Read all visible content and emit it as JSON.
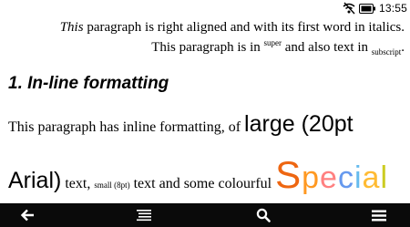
{
  "status_bar": {
    "time": "13:55",
    "icons": [
      "wifi-off-icon",
      "battery-icon"
    ]
  },
  "document": {
    "p1": {
      "em": "This",
      "rest": " paragraph is right aligned and with its first word in italics."
    },
    "p2": {
      "before": "This paragraph is in ",
      "sup": "super",
      "middle": " and also text in ",
      "sub": "subscript",
      "end": "."
    },
    "heading": "1. In-line formatting",
    "p3": {
      "t1": "This paragraph has inline formatting, of ",
      "large1": "large (20pt",
      "large2": "Arial)",
      "t2": " text, ",
      "small": "small (8pt)",
      "t3": " text and some colourful ",
      "special": [
        "S",
        "p",
        "e",
        "c",
        "i",
        "a",
        "l"
      ]
    }
  },
  "nav_bar": {
    "icons": [
      "back-arrow-icon",
      "menu-list-icon",
      "search-icon",
      "options-menu-icon"
    ]
  },
  "colors": {
    "nav_bg": "#0a0a0a",
    "special_letters": [
      "#ee6611",
      "#ff9922",
      "#ff8080",
      "#6699ee",
      "#66bbee",
      "#ffbb33",
      "#cccc22"
    ]
  }
}
